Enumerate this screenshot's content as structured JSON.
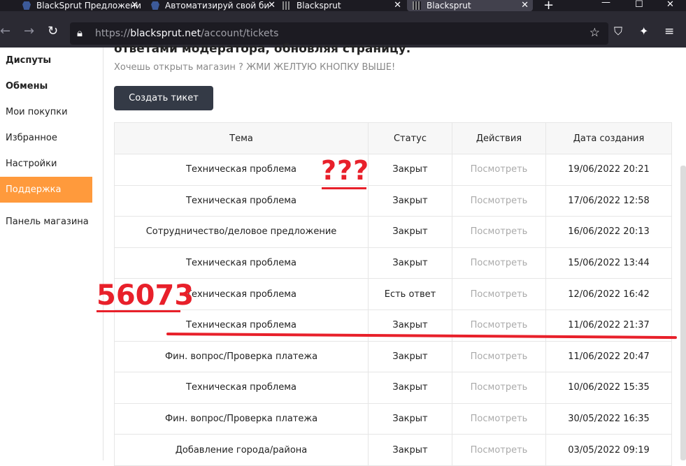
{
  "browser": {
    "tabs": [
      {
        "title": "BlackSprut Предложени",
        "favicon": "blue-shield"
      },
      {
        "title": "Автоматизируй свой би",
        "favicon": "blue-shield"
      },
      {
        "title": "Blacksprut",
        "favicon": "bars"
      },
      {
        "title": "Blacksprut",
        "favicon": "bars",
        "active": true
      }
    ],
    "url_prefix": "https://",
    "url_host": "blacksprut.net",
    "url_path": "/account/tickets"
  },
  "sidebar": {
    "items": [
      {
        "label": "Диспуты",
        "bold": true
      },
      {
        "label": "Обмены",
        "bold": true
      },
      {
        "label": "Мои покупки"
      },
      {
        "label": "Избранное"
      },
      {
        "label": "Настройки"
      },
      {
        "label": "Поддержка",
        "active": true
      },
      {
        "label": "Панель магазина"
      }
    ]
  },
  "main": {
    "heading_partial": "ответами модератора, обновляя страницу.",
    "hint": "Хочешь открыть магазин ? ЖМИ ЖЕЛТУЮ КНОПКУ ВЫШЕ!",
    "create_button": "Создать тикет"
  },
  "table": {
    "headers": [
      "Тема",
      "Статус",
      "Действия",
      "Дата создания"
    ],
    "rows": [
      [
        "Техническая проблема",
        "Закрыт",
        "Посмотреть",
        "19/06/2022 20:21"
      ],
      [
        "Техническая проблема",
        "Закрыт",
        "Посмотреть",
        "17/06/2022 12:58"
      ],
      [
        "Сотрудничество/деловое предложение",
        "Закрыт",
        "Посмотреть",
        "16/06/2022 20:13"
      ],
      [
        "Техническая проблема",
        "Закрыт",
        "Посмотреть",
        "15/06/2022 13:44"
      ],
      [
        "Техническая проблема",
        "Есть ответ",
        "Посмотреть",
        "12/06/2022 16:42"
      ],
      [
        "Техническая проблема",
        "Закрыт",
        "Посмотреть",
        "11/06/2022 21:37"
      ],
      [
        "Фин. вопрос/Проверка платежа",
        "Закрыт",
        "Посмотреть",
        "11/06/2022 20:47"
      ],
      [
        "Техническая проблема",
        "Закрыт",
        "Посмотреть",
        "10/06/2022 15:35"
      ],
      [
        "Фин. вопрос/Проверка платежа",
        "Закрыт",
        "Посмотреть",
        "30/05/2022 16:35"
      ],
      [
        "Добавление города/района",
        "Закрыт",
        "Посмотреть",
        "03/05/2022 09:19"
      ]
    ]
  },
  "annotations": {
    "question_marks": "???",
    "number": "56073",
    "color": "#e8202a"
  },
  "colors": {
    "accent": "#ff9a3c",
    "button_dark": "#343a46"
  }
}
